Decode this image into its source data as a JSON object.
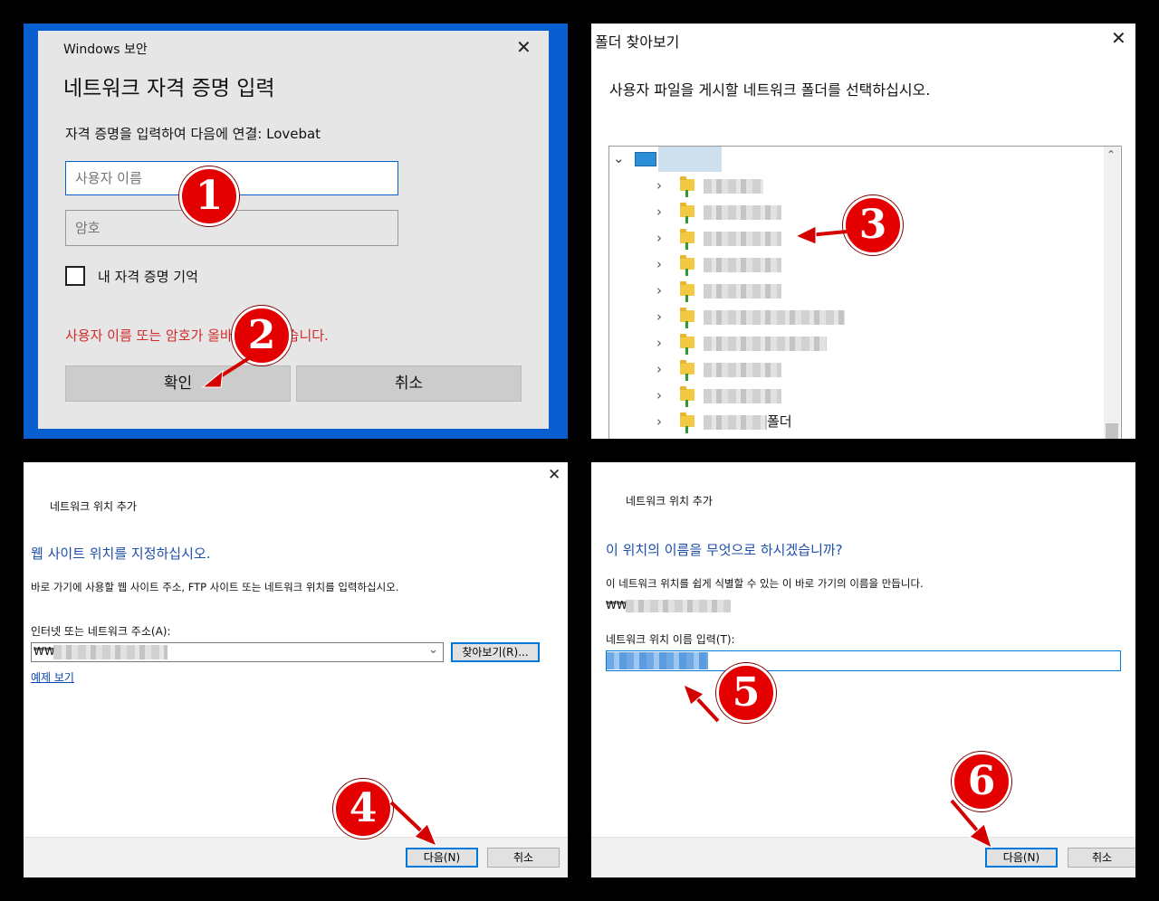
{
  "panel1": {
    "dialog_title": "Windows 보안",
    "heading": "네트워크 자격 증명 입력",
    "prompt": "자격 증명을 입력하여 다음에 연결: Lovebat",
    "username_placeholder": "사용자 이름",
    "password_placeholder": "암호",
    "remember_label": "내 자격 증명 기억",
    "error_text": "사용자 이름 또는 암호가 올바르지 않았습니다.",
    "ok_label": "확인",
    "cancel_label": "취소",
    "accent_color": "#0a5fd0",
    "error_color": "#d32a2a"
  },
  "panel2": {
    "dialog_title": "폴더 찾아보기",
    "instruction": "사용자 파일을 게시할 네트워크 폴더를 선택하십시오.",
    "last_item_suffix": "폴더",
    "visible_item_count": 10
  },
  "panel3": {
    "wizard_title": "네트워크 위치 추가",
    "heading": "웹 사이트 위치를 지정하십시오.",
    "description": "바로 가기에 사용할 웹 사이트 주소, FTP 사이트 또는 네트워크 위치를 입력하십시오.",
    "address_label": "인터넷 또는 네트워크 주소(A):",
    "address_value_prefix": "₩₩",
    "browse_label": "찾아보기(R)...",
    "examples_link": "예제 보기",
    "next_label": "다음(N)",
    "cancel_label": "취소"
  },
  "panel4": {
    "wizard_title": "네트워크 위치 추가",
    "heading": "이 위치의 이름을 무엇으로 하시겠습니까?",
    "description": "이 네트워크 위치를 쉽게 식별할 수 있는 이 바로 가기의 이름을 만듭니다.",
    "path_prefix": "₩₩",
    "name_label": "네트워크 위치 이름 입력(T):",
    "next_label": "다음(N)",
    "cancel_label": "취소"
  },
  "markers": [
    "1",
    "2",
    "3",
    "4",
    "5",
    "6"
  ]
}
